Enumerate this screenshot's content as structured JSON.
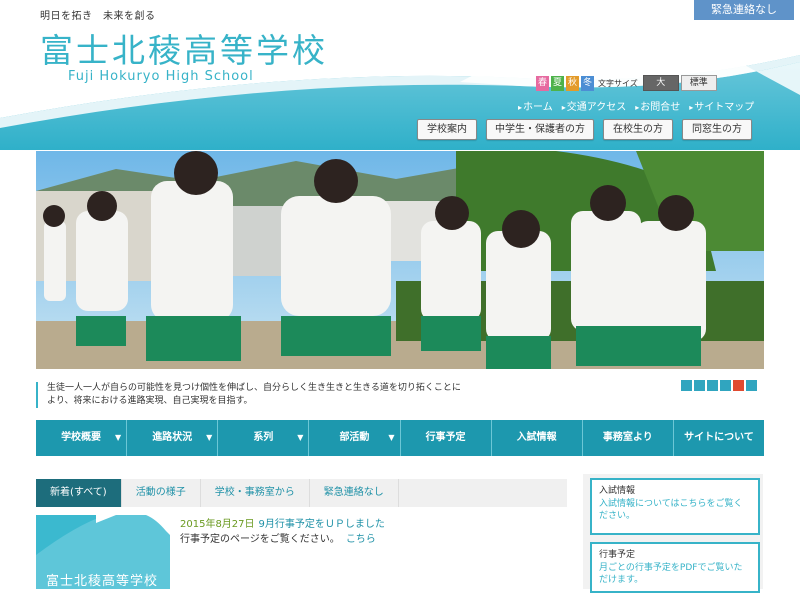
{
  "header": {
    "tagline": "明日を拓き　未来を創る",
    "title": "富士北稜高等学校",
    "title_en": "Fuji Hokuryo High School",
    "emergency_label": "緊急連絡なし"
  },
  "season_buttons": [
    {
      "label": "春",
      "color": "#e66aa0"
    },
    {
      "label": "夏",
      "color": "#4db24a"
    },
    {
      "label": "秋",
      "color": "#e39b2a"
    },
    {
      "label": "冬",
      "color": "#4c8ed4"
    }
  ],
  "font_size": {
    "label": "文字サイズ",
    "large": "大",
    "standard": "標準"
  },
  "util_nav": [
    "ホーム",
    "交通アクセス",
    "お問合せ",
    "サイトマップ"
  ],
  "audience_buttons": [
    "学校案内",
    "中学生・保護者の方",
    "在校生の方",
    "同窓生の方"
  ],
  "mission": "生徒一人一人が自らの可能性を見つけ個性を伸ばし、自分らしく生き生きと生きる道を切り拓くことにより、将来における進路実現、自己実現を目指す。",
  "slider": {
    "count": 6,
    "active_index": 4
  },
  "main_nav": [
    {
      "label": "学校概要",
      "dropdown": true
    },
    {
      "label": "進路状況",
      "dropdown": true
    },
    {
      "label": "系列",
      "dropdown": true
    },
    {
      "label": "部活動",
      "dropdown": true
    },
    {
      "label": "行事予定",
      "dropdown": false
    },
    {
      "label": "入試情報",
      "dropdown": false
    },
    {
      "label": "事務室より",
      "dropdown": false
    },
    {
      "label": "サイトについて",
      "dropdown": false
    }
  ],
  "news_tabs": [
    "新着(すべて)",
    "活動の様子",
    "学校・事務室から",
    "緊急連絡なし"
  ],
  "news": {
    "thumb_title": "富士北稜高等学校",
    "date": "2015年8月27日",
    "headline": "9月行事予定をＵＰしました",
    "body": "行事予定のページをご覧ください。",
    "link": "こちら"
  },
  "sidebar": [
    {
      "title": "入試情報",
      "body": "入試情報についてはこちらをご覧ください。"
    },
    {
      "title": "行事予定",
      "body": "月ごとの行事予定をPDFでご覧いただけます。"
    }
  ],
  "colors": {
    "accent": "#37b3c8",
    "nav": "#1d98ae",
    "tab_active": "#1d6d7c",
    "emergency": "#5f93c9",
    "slider_active": "#e04a30"
  }
}
